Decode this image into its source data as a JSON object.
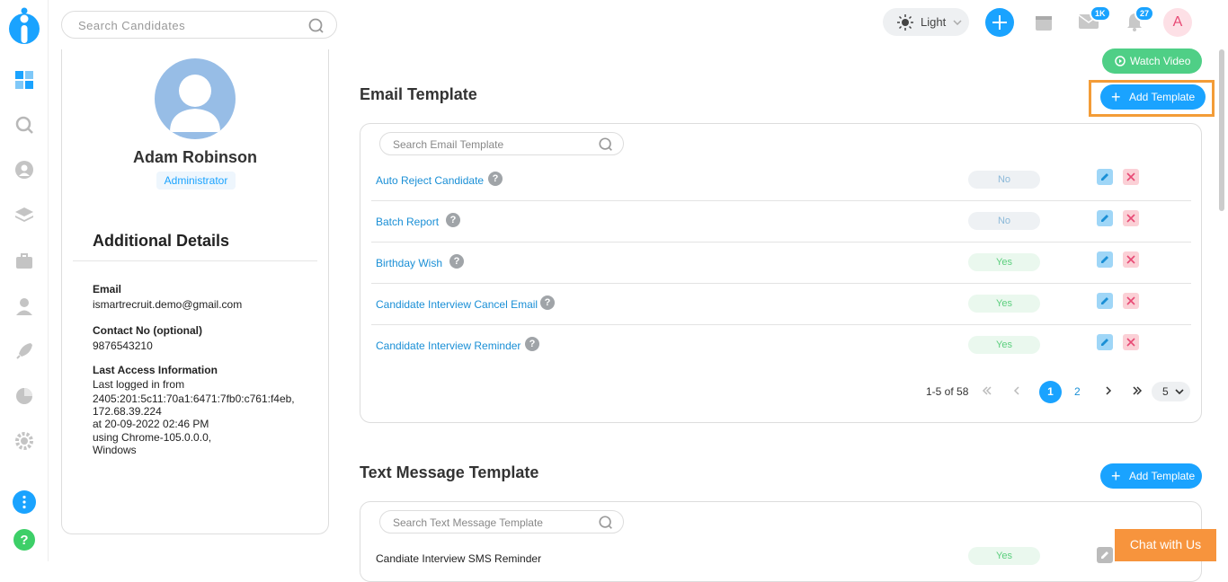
{
  "topbar": {
    "search_placeholder": "Search Candidates",
    "theme_label": "Light",
    "mail_badge": "1K",
    "notif_badge": "27",
    "user_initial": "A"
  },
  "profile": {
    "name": "Adam Robinson",
    "role": "Administrator",
    "section_title": "Additional Details",
    "email_label": "Email",
    "email": "ismartrecruit.demo@gmail.com",
    "contact_label": "Contact No (optional)",
    "contact": "9876543210",
    "access_label": "Last Access Information",
    "access_lines": [
      "Last logged in from",
      "2405:201:5c11:70a1:6471:7fb0:c761:f4eb,",
      "172.68.39.224",
      "at 20-09-2022 02:46 PM",
      "using Chrome-105.0.0.0,",
      "Windows"
    ]
  },
  "email_section": {
    "watch_video": "Watch Video",
    "title": "Email Template",
    "add_button": "Add Template",
    "search_placeholder": "Search Email Template",
    "rows": [
      {
        "name": "Auto Reject Candidate",
        "status": "No"
      },
      {
        "name": "Batch Report",
        "status": "No"
      },
      {
        "name": "Birthday Wish",
        "status": "Yes"
      },
      {
        "name": "Candidate Interview Cancel Email",
        "status": "Yes"
      },
      {
        "name": "Candidate Interview Reminder",
        "status": "Yes"
      }
    ],
    "pagination": {
      "range": "1-5 of 58",
      "page1": "1",
      "page2": "2",
      "per_page": "5"
    }
  },
  "sms_section": {
    "title": "Text Message Template",
    "add_button": "Add Template",
    "search_placeholder": "Search Text Message Template",
    "rows": [
      {
        "name": "Candiate Interview SMS Reminder",
        "status": "Yes"
      }
    ]
  },
  "chat": {
    "label": "Chat with Us"
  },
  "colors": {
    "accent": "#1aa3ff",
    "highlight": "#f39c37",
    "watch": "#4fcf86",
    "chat": "#f7943d"
  }
}
